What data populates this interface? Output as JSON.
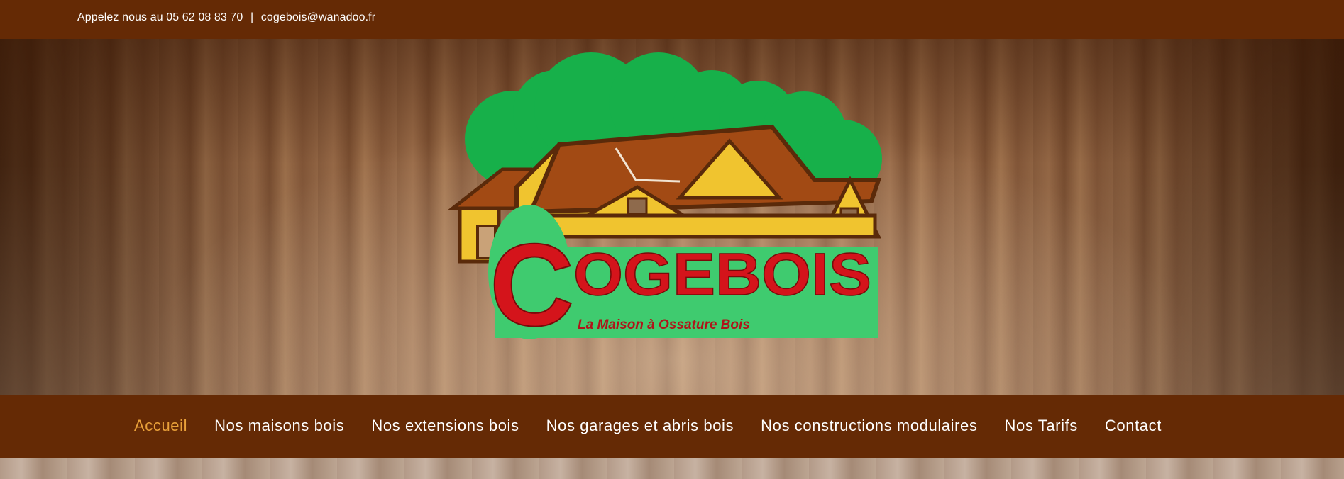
{
  "topbar": {
    "phone_text": "Appelez nous au 05 62 08 83 70",
    "separator": "|",
    "email": "cogebois@wanadoo.fr"
  },
  "logo": {
    "brand": "COGEBOIS",
    "brand_first_letter": "C",
    "brand_rest": "OGEBOIS",
    "tagline": "La Maison à Ossature Bois"
  },
  "nav": {
    "items": [
      {
        "label": "Accueil",
        "active": true
      },
      {
        "label": "Nos maisons bois",
        "active": false
      },
      {
        "label": "Nos extensions bois",
        "active": false
      },
      {
        "label": "Nos garages et abris bois",
        "active": false
      },
      {
        "label": "Nos constructions modulaires",
        "active": false
      },
      {
        "label": "Nos Tarifs",
        "active": false
      },
      {
        "label": "Contact",
        "active": false
      }
    ]
  },
  "colors": {
    "bar_brown": "#652a05",
    "active_link": "#e9a13a",
    "logo_green": "#3fcb6f",
    "logo_red": "#d4141b",
    "roof_brown": "#a24a14",
    "gable_yellow": "#f0c42f"
  }
}
